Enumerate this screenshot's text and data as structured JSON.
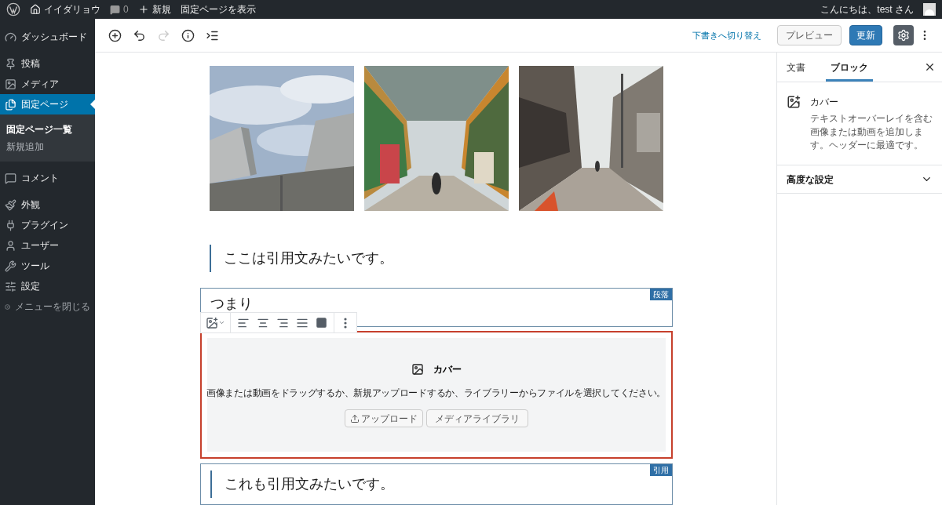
{
  "admin_bar": {
    "site_name": "イイダリョウ",
    "comments_count": "0",
    "new_label": "新規",
    "view_page": "固定ページを表示",
    "greeting": "こんにちは、test さん"
  },
  "menu": [
    {
      "kind": "gauge",
      "label": "ダッシュボード",
      "selected": false
    },
    {
      "kind": "pin",
      "label": "投稿",
      "selected": false
    },
    {
      "kind": "media",
      "label": "メディア",
      "selected": false
    },
    {
      "kind": "pages",
      "label": "固定ページ",
      "selected": true,
      "children": [
        {
          "label": "固定ページ一覧",
          "selected": true
        },
        {
          "label": "新規追加",
          "selected": false
        }
      ]
    },
    {
      "kind": "comment",
      "label": "コメント",
      "selected": false
    },
    {
      "kind": "brush",
      "label": "外観",
      "selected": false
    },
    {
      "kind": "plug",
      "label": "プラグイン",
      "selected": false
    },
    {
      "kind": "user",
      "label": "ユーザー",
      "selected": false
    },
    {
      "kind": "wrench",
      "label": "ツール",
      "selected": false
    },
    {
      "kind": "sliders",
      "label": "設定",
      "selected": false
    },
    {
      "kind": "collapse",
      "label": "メニューを閉じる",
      "selected": false
    }
  ],
  "toolbar": {
    "tools": [
      {
        "kind": "add",
        "disabled": false
      },
      {
        "kind": "undo",
        "disabled": false
      },
      {
        "kind": "redo",
        "disabled": true
      },
      {
        "kind": "info",
        "disabled": false
      },
      {
        "kind": "outline",
        "disabled": false
      }
    ],
    "switch_to_draft": "下書きへ切り替え",
    "preview": "プレビュー",
    "update": "更新"
  },
  "blocks": [
    {
      "kind": "gallery"
    },
    {
      "kind": "quote",
      "text": "ここは引用文みたいです。"
    },
    {
      "kind": "paragraph",
      "text": "つまり",
      "label": "段落"
    },
    {
      "kind": "cover",
      "title": "カバー",
      "instructions": "画像または動画をドラッグするか、新規アップロードするか、ライブラリーからファイルを選択してください。",
      "upload": "アップロード",
      "media_library": "メディアライブラリ",
      "selected": true
    },
    {
      "kind": "quote",
      "text": "これも引用文みたいです。",
      "label": "引用"
    }
  ],
  "settings_sidebar": {
    "tabs": [
      {
        "label": "文書",
        "selected": false
      },
      {
        "label": "ブロック",
        "selected": true
      }
    ],
    "block_name": "カバー",
    "block_description": "テキストオーバーレイを含む画像または動画を追加します。ヘッダーに最適です。",
    "advanced": {
      "label": "高度な設定",
      "expanded": false
    }
  }
}
